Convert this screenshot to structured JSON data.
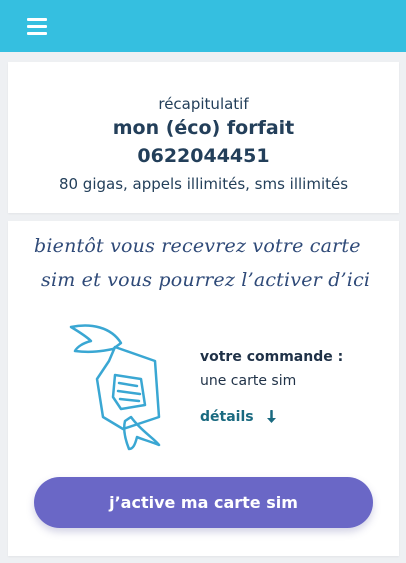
{
  "header": {
    "menu_icon": "hamburger-icon",
    "color": "#35bfe0"
  },
  "summary": {
    "label": "récapitulatif",
    "title": "mon (éco) forfait",
    "number": "0622044451",
    "details": "80 gigas, appels illimités, sms illimités"
  },
  "order": {
    "message_line1": "bientôt vous recevrez votre carte",
    "message_line2": "sim et vous pourrez l’activer d’ici",
    "illustration_icon": "flying-sim-card-icon",
    "command_label": "votre commande :",
    "command_value": "une carte sim",
    "details_link": "détails",
    "details_icon": "arrow-down-icon",
    "cta_label": "j’active ma carte sim",
    "cta_color": "#6a67c6"
  }
}
